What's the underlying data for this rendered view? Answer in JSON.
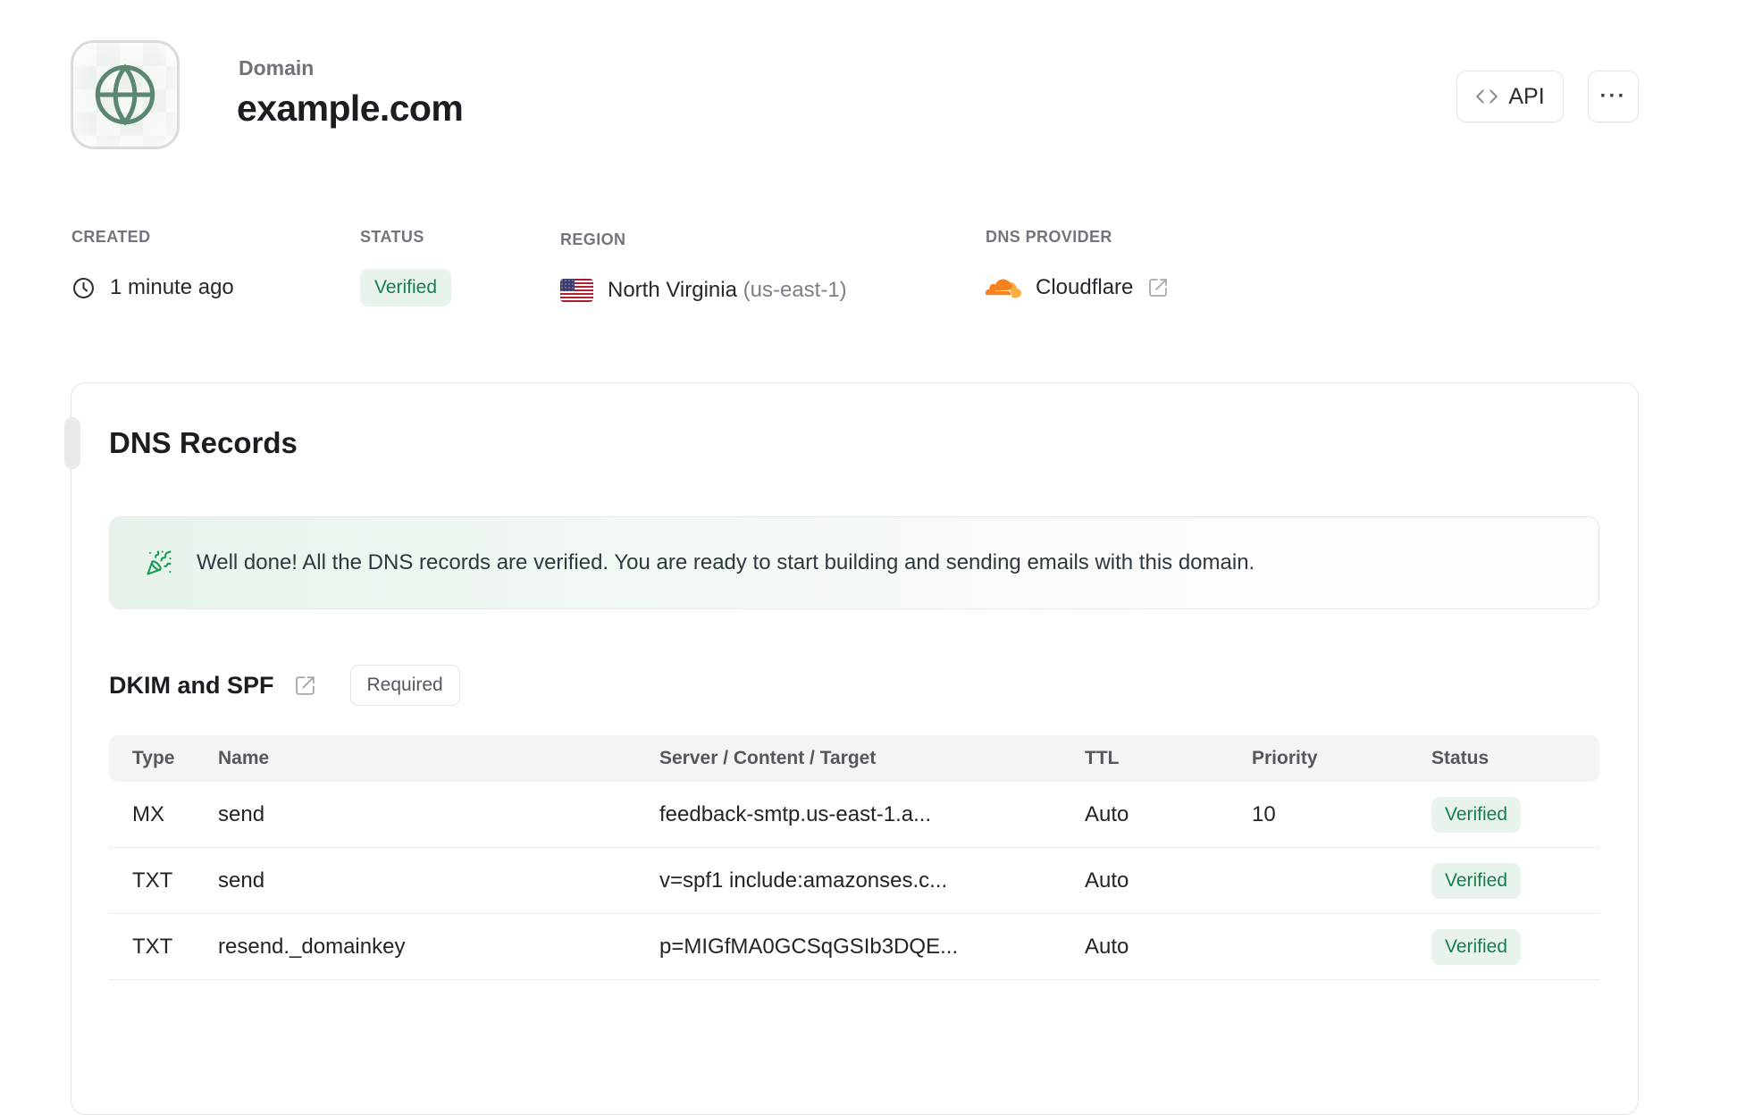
{
  "header": {
    "eyebrow": "Domain",
    "title": "example.com",
    "api_button_label": "API",
    "more_button_label": "···"
  },
  "meta": {
    "created": {
      "label": "CREATED",
      "value": "1 minute ago"
    },
    "status": {
      "label": "STATUS",
      "value": "Verified"
    },
    "region": {
      "label": "REGION",
      "value": "North Virginia",
      "code": "(us-east-1)"
    },
    "dns_provider": {
      "label": "DNS PROVIDER",
      "value": "Cloudflare"
    }
  },
  "dns_card": {
    "title": "DNS Records",
    "banner_text": "Well done! All the DNS records are verified. You are ready to start building and sending emails with this domain.",
    "section": {
      "title": "DKIM and SPF",
      "badge": "Required"
    },
    "table": {
      "headers": [
        "Type",
        "Name",
        "Server / Content / Target",
        "TTL",
        "Priority",
        "Status"
      ],
      "rows": [
        {
          "type": "MX",
          "name": "send",
          "content": "feedback-smtp.us-east-1.a...",
          "ttl": "Auto",
          "priority": "10",
          "status": "Verified"
        },
        {
          "type": "TXT",
          "name": "send",
          "content": "v=spf1 include:amazonses.c...",
          "ttl": "Auto",
          "priority": "",
          "status": "Verified"
        },
        {
          "type": "TXT",
          "name": "resend._domainkey",
          "content": "p=MIGfMA0GCSqGSIb3DQE...",
          "ttl": "Auto",
          "priority": "",
          "status": "Verified"
        }
      ]
    }
  },
  "colors": {
    "accent_green": "#15804f",
    "badge_bg": "#e8f3ec",
    "globe_green": "#5b8770",
    "cloudflare_orange": "#f6821f",
    "cloudflare_light_orange": "#fbad41",
    "border": "#e4e4e7",
    "muted_text": "#70757e"
  }
}
